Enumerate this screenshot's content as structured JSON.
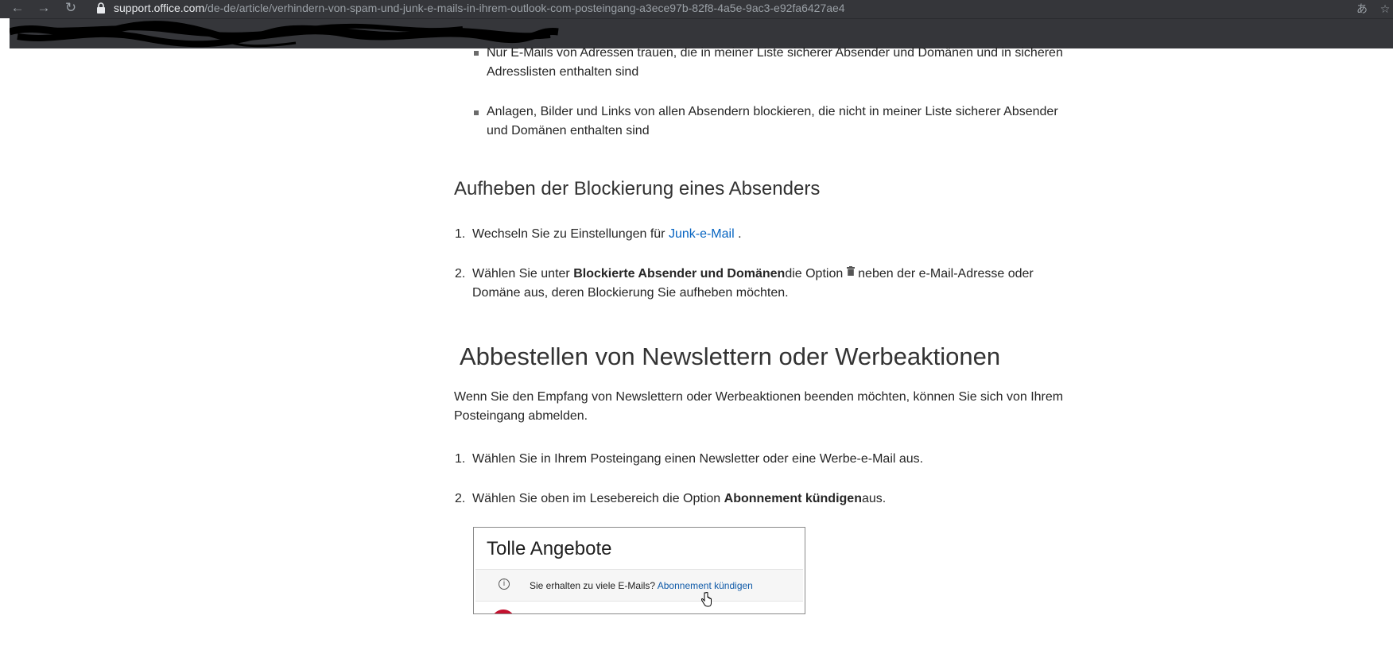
{
  "browser": {
    "url_host": "support.office.com",
    "url_path": "/de-de/article/verhindern-von-spam-und-junk-e-mails-in-ihrem-outlook-com-posteingang-a3ece97b-82f8-4a5e-9ac3-e92fa6427ae4",
    "back_icon": "arrow-left-icon",
    "forward_icon": "arrow-right-icon",
    "reload_icon": "reload-icon",
    "translate_icon": "translate-icon",
    "star_icon": "star-icon"
  },
  "article": {
    "bullets": [
      "Nur E-Mails von Adressen trauen, die in meiner Liste sicherer Absender und Domänen und in sicheren Adresslisten enthalten sind",
      "Anlagen, Bilder und Links von allen Absendern blockieren, die nicht in meiner Liste sicherer Absender und Domänen enthalten sind"
    ],
    "section_unblock": {
      "heading": "Aufheben der Blockierung eines Absenders",
      "step1_num": "1.",
      "step1_text": "Wechseln Sie zu Einstellungen für ",
      "step1_link": "Junk-e-Mail",
      "step1_end": " .",
      "step2_num": "2.",
      "step2_pre": "Wählen Sie unter ",
      "step2_bold": "Blockierte Absender und Domänen",
      "step2_mid": "die Option ",
      "step2_icon": "trash-icon",
      "step2_post": " neben der e-Mail-Adresse oder Domäne aus, deren Blockierung Sie aufheben möchten."
    },
    "section_unsubscribe": {
      "heading": "Abbestellen von Newslettern oder Werbeaktionen",
      "intro": "Wenn Sie den Empfang von Newslettern oder Werbeaktionen beenden möchten, können Sie sich von Ihrem Posteingang abmelden.",
      "step1_num": "1.",
      "step1_text": "Wählen Sie in Ihrem Posteingang einen Newsletter oder eine Werbe-e-Mail aus.",
      "step2_num": "2.",
      "step2_pre": "Wählen Sie oben im Lesebereich die Option ",
      "step2_bold": "Abonnement kündigen",
      "step2_post": "aus."
    },
    "screenshot": {
      "title": "Tolle Angebote",
      "info_icon": "info-icon",
      "question": "Sie erhalten zu viele E-Mails? ",
      "link": "Abonnement kündigen",
      "cursor_icon": "hand-pointer-icon"
    }
  }
}
